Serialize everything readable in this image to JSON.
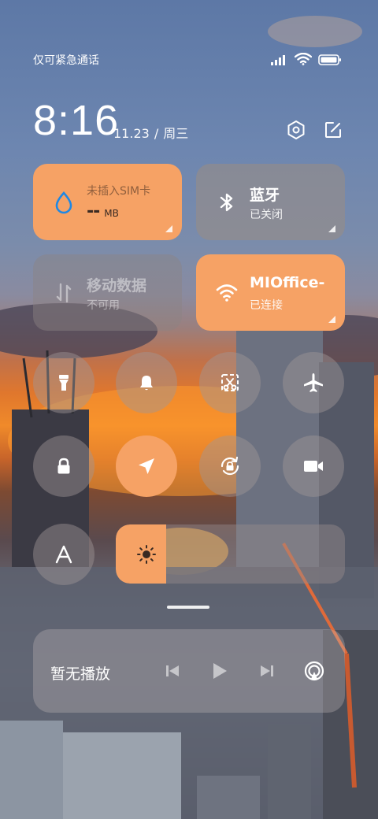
{
  "status": {
    "carrier": "仅可紧急通话"
  },
  "header": {
    "time": "8:16",
    "date": "11.23",
    "separator": "/",
    "weekday": "周三",
    "settings_icon": "hexagon-settings-icon",
    "edit_icon": "edit-icon"
  },
  "tiles": {
    "sim": {
      "title": "未插入SIM卡",
      "value": "--",
      "unit": "MB",
      "icon": "water-drop-icon"
    },
    "bluetooth": {
      "title": "蓝牙",
      "status": "已关闭",
      "icon": "bluetooth-icon"
    },
    "mobile_data": {
      "title": "移动数据",
      "status": "不可用",
      "icon": "data-arrows-icon"
    },
    "wifi": {
      "title": "MIOffice-",
      "status": "已连接",
      "icon": "wifi-icon"
    }
  },
  "toggles": [
    {
      "name": "flashlight",
      "icon": "flashlight-icon",
      "active": false
    },
    {
      "name": "silent",
      "icon": "bell-icon",
      "active": false
    },
    {
      "name": "screenshot",
      "icon": "scissors-icon",
      "active": false
    },
    {
      "name": "airplane",
      "icon": "airplane-icon",
      "active": false
    },
    {
      "name": "lock",
      "icon": "lock-icon",
      "active": false
    },
    {
      "name": "location",
      "icon": "location-arrow-icon",
      "active": true
    },
    {
      "name": "rotation",
      "icon": "rotation-lock-icon",
      "active": false
    },
    {
      "name": "screen-record",
      "icon": "video-camera-icon",
      "active": false
    },
    {
      "name": "font",
      "icon": "font-a-icon",
      "active": false
    }
  ],
  "brightness": {
    "level": 0.22,
    "icon": "sun-icon"
  },
  "media": {
    "title": "暂无播放"
  },
  "colors": {
    "accent": "#f6a265",
    "tile_off": "#8c8787"
  }
}
